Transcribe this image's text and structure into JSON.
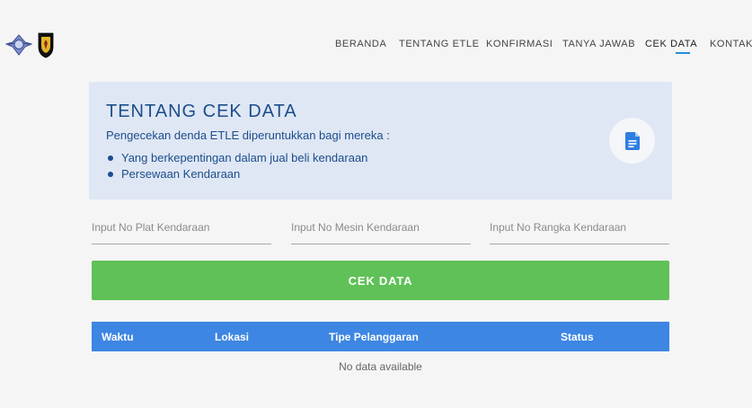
{
  "nav": {
    "items": [
      {
        "label": "BERANDA"
      },
      {
        "label": "TENTANG ETLE"
      },
      {
        "label": "KONFIRMASI"
      },
      {
        "label": "TANYA JAWAB"
      },
      {
        "label": "CEK DATA"
      },
      {
        "label": "KONTAK"
      }
    ],
    "active": "CEK DATA",
    "accent_color": "#1f8fd6"
  },
  "about": {
    "title": "TENTANG CEK DATA",
    "description": "Pengecekan denda ETLE diperuntukkan bagi mereka :",
    "bullets": [
      "Yang berkepentingan dalam jual beli kendaraan",
      "Persewaan Kendaraan"
    ],
    "icon": "document-icon",
    "background_color": "#dfe7f4"
  },
  "form": {
    "plate_placeholder": "Input No Plat Kendaraan",
    "engine_placeholder": "Input No Mesin Kendaraan",
    "frame_placeholder": "Input No Rangka Kendaraan",
    "submit_label": "CEK DATA",
    "submit_color": "#5fc157"
  },
  "table": {
    "columns": [
      "Waktu",
      "Lokasi",
      "Tipe Pelanggaran",
      "Status"
    ],
    "empty_text": "No data available",
    "header_color": "#3d86e3"
  }
}
